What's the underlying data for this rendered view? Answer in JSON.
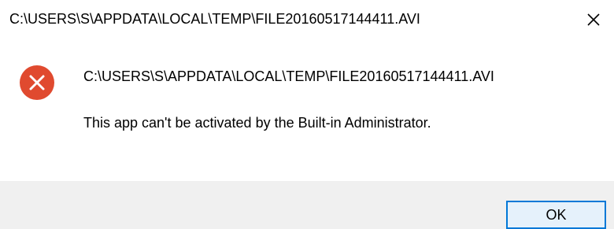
{
  "window": {
    "title": "C:\\USERS\\S\\APPDATA\\LOCAL\\TEMP\\FILE20160517144411.AVI",
    "close_icon": "close-icon"
  },
  "content": {
    "icon": "error-icon",
    "path": "C:\\USERS\\S\\APPDATA\\LOCAL\\TEMP\\FILE20160517144411.AVI",
    "message": "This app can't be activated by the Built-in Administrator."
  },
  "footer": {
    "ok_label": "OK"
  },
  "colors": {
    "error_red": "#e81123",
    "accent": "#0078d7",
    "footer_bg": "#f0f0f0"
  }
}
